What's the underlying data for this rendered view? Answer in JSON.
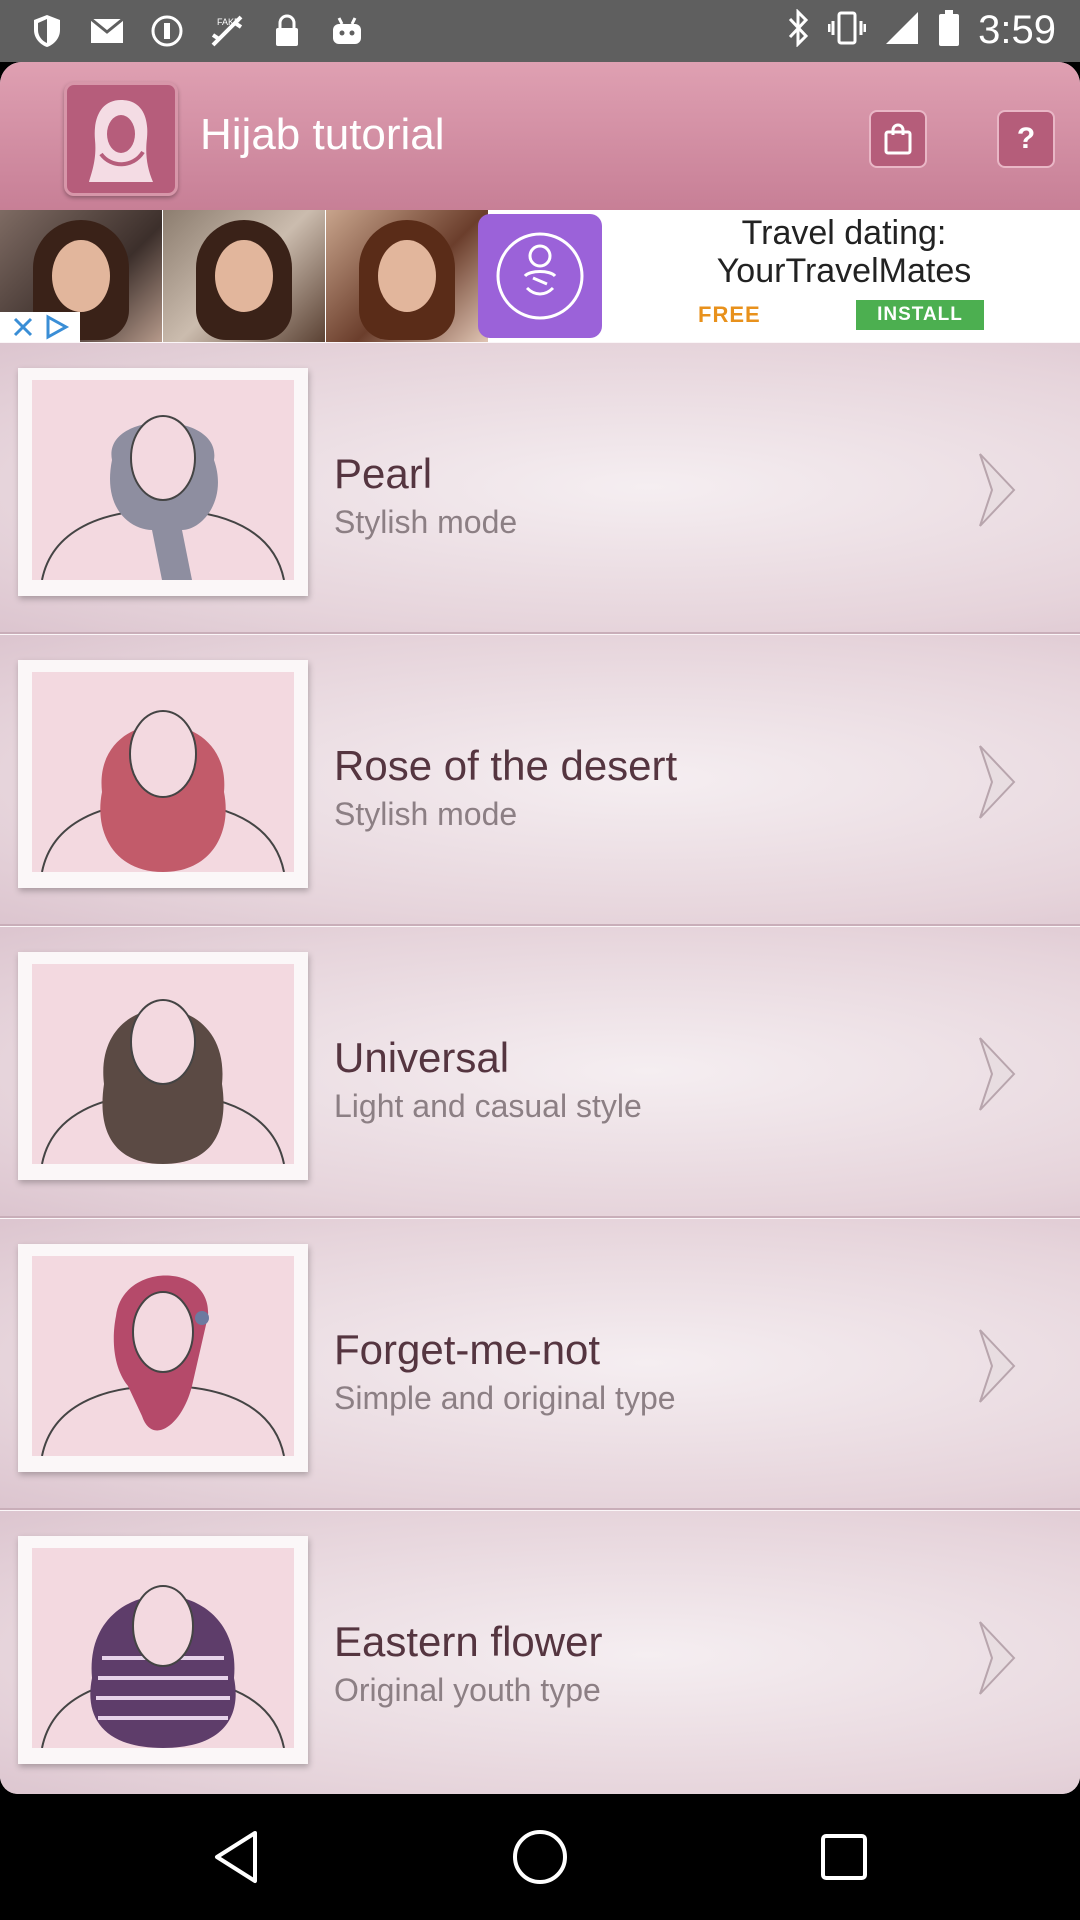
{
  "status_bar": {
    "time": "3:59",
    "left_icons": [
      "shield-icon",
      "mail-icon",
      "info-icon",
      "fake-gps-icon",
      "lock-icon",
      "android-icon"
    ],
    "right_icons": [
      "bluetooth-icon",
      "vibrate-icon",
      "signal-icon",
      "battery-icon"
    ]
  },
  "header": {
    "title": "Hijab tutorial",
    "shop_icon": "shopping-bag-icon",
    "help_label": "?"
  },
  "ad": {
    "title": "Travel dating: YourTravelMates",
    "free_label": "FREE",
    "install_label": "INSTALL"
  },
  "list": {
    "items": [
      {
        "title": "Pearl",
        "subtitle": "Stylish mode",
        "scarf_color": "#8e8ea0"
      },
      {
        "title": "Rose of the desert",
        "subtitle": "Stylish mode",
        "scarf_color": "#c25b6a"
      },
      {
        "title": "Universal",
        "subtitle": "Light and casual style",
        "scarf_color": "#5b4a44"
      },
      {
        "title": "Forget-me-not",
        "subtitle": "Simple and original type",
        "scarf_color": "#b54a6a"
      },
      {
        "title": "Eastern flower",
        "subtitle": "Original youth type",
        "scarf_color": "#5e3d6a"
      }
    ]
  },
  "colors": {
    "header_bg": "#c77f96",
    "list_bg": "#efe6ea",
    "title_text": "#553540",
    "subtitle_text": "#8c7f84",
    "ad_install": "#4caf50",
    "ad_free": "#e8911c"
  }
}
